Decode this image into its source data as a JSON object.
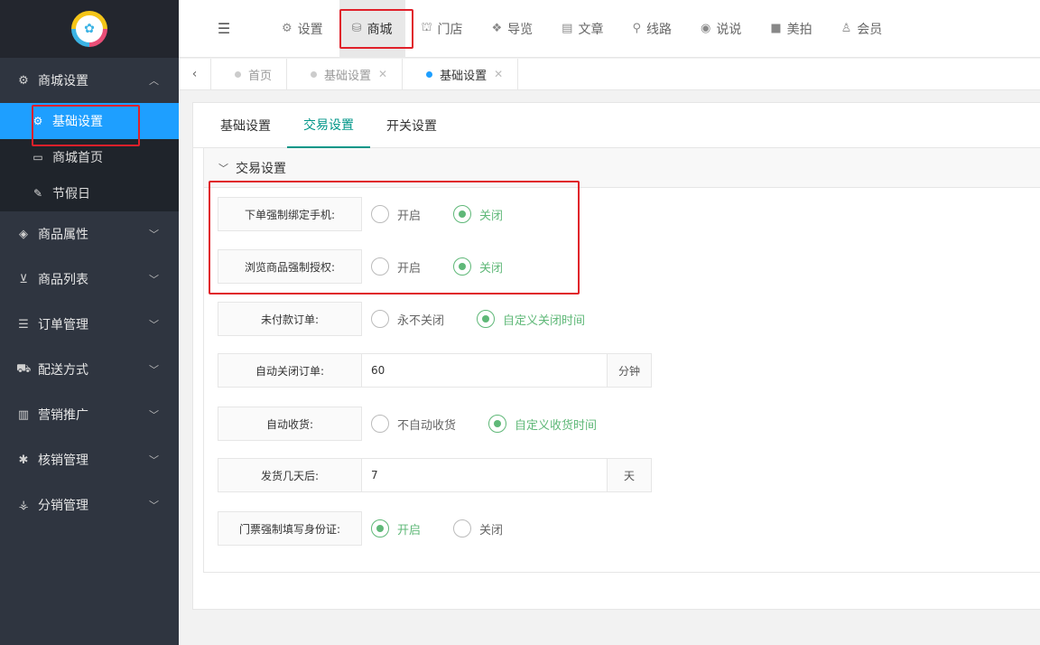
{
  "sidebar": {
    "items": [
      {
        "label": "商城设置",
        "icon": "gears-icon"
      },
      {
        "label": "商品属性",
        "icon": "cube-icon"
      },
      {
        "label": "商品列表",
        "icon": "cart-icon"
      },
      {
        "label": "订单管理",
        "icon": "list-icon"
      },
      {
        "label": "配送方式",
        "icon": "car-icon"
      },
      {
        "label": "营销推广",
        "icon": "bar-chart-icon"
      },
      {
        "label": "核销管理",
        "icon": "asterisk-icon"
      },
      {
        "label": "分销管理",
        "icon": "sitemap-icon"
      }
    ],
    "subitems": [
      {
        "label": "基础设置"
      },
      {
        "label": "商城首页"
      },
      {
        "label": "节假日"
      }
    ]
  },
  "topnav": {
    "tabs": [
      {
        "label": "设置"
      },
      {
        "label": "商城"
      },
      {
        "label": "门店"
      },
      {
        "label": "导览"
      },
      {
        "label": "文章"
      },
      {
        "label": "线路"
      },
      {
        "label": "说说"
      },
      {
        "label": "美拍"
      },
      {
        "label": "会员"
      }
    ]
  },
  "pagetabs": [
    {
      "label": "首页"
    },
    {
      "label": "基础设置"
    },
    {
      "label": "基础设置"
    }
  ],
  "content": {
    "tabs": [
      {
        "label": "基础设置"
      },
      {
        "label": "交易设置"
      },
      {
        "label": "开关设置"
      }
    ],
    "section_title": "交易设置",
    "fields": {
      "bind_phone": {
        "label": "下单强制绑定手机:",
        "opt1": "开启",
        "opt2": "关闭",
        "selected": "关闭"
      },
      "browse_auth": {
        "label": "浏览商品强制授权:",
        "opt1": "开启",
        "opt2": "关闭",
        "selected": "关闭"
      },
      "unpaid_order": {
        "label": "未付款订单:",
        "opt1": "永不关闭",
        "opt2": "自定义关闭时间",
        "selected": "自定义关闭时间"
      },
      "auto_close": {
        "label": "自动关闭订单:",
        "value": "60",
        "suffix": "分钟"
      },
      "auto_receive": {
        "label": "自动收货:",
        "opt1": "不自动收货",
        "opt2": "自定义收货时间",
        "selected": "自定义收货时间"
      },
      "ship_days": {
        "label": "发货几天后:",
        "value": "7",
        "suffix": "天"
      },
      "ticket_id": {
        "label": "门票强制填写身份证:",
        "opt1": "开启",
        "opt2": "关闭",
        "selected": "开启"
      }
    }
  },
  "colors": {
    "sidebar_bg": "#2f3540",
    "active_blue": "#1e9fff",
    "green": "#5fb878",
    "teal": "#009688",
    "highlight_red": "#e0202a"
  }
}
